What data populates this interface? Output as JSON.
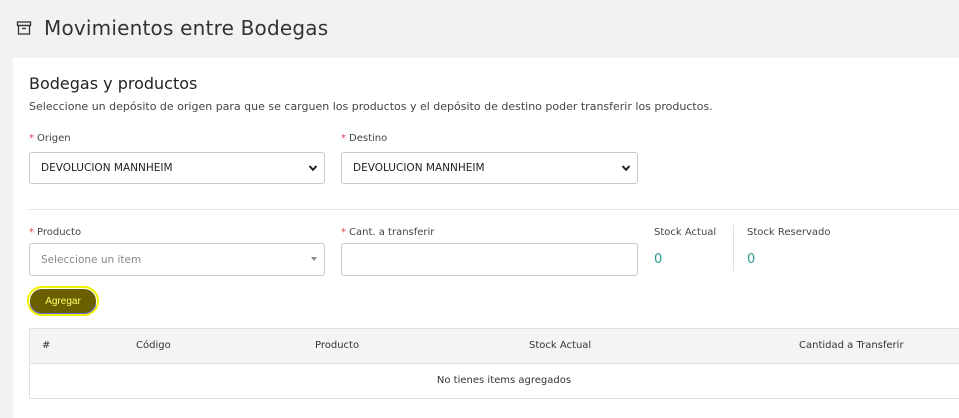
{
  "header": {
    "title": "Movimientos entre Bodegas",
    "icon": "archive-icon"
  },
  "card": {
    "title": "Bodegas y productos",
    "description": "Seleccione un depósito de origen para que se carguen los productos y el depósito de destino poder transferir los productos."
  },
  "form": {
    "required_mark": "*",
    "origen_label": "Origen",
    "origen_value": "DEVOLUCION MANNHEIM",
    "destino_label": "Destino",
    "destino_value": "DEVOLUCION MANNHEIM",
    "producto_label": "Producto",
    "producto_placeholder": "Seleccione un item",
    "cantidad_label": "Cant. a transferir",
    "cantidad_value": "",
    "stock_actual_label": "Stock Actual",
    "stock_actual_value": "0",
    "stock_reservado_label": "Stock Reservado",
    "stock_reservado_value": "0",
    "agregar_label": "Agregar"
  },
  "table": {
    "columns": [
      "#",
      "Código",
      "Producto",
      "Stock Actual",
      "Cantidad a Transferir"
    ],
    "empty_message": "No tienes items agregados"
  },
  "colors": {
    "accent_teal": "#2a9a8e",
    "required": "#e0474f",
    "button_bg": "#6a5f00",
    "button_text": "#ffff66"
  }
}
